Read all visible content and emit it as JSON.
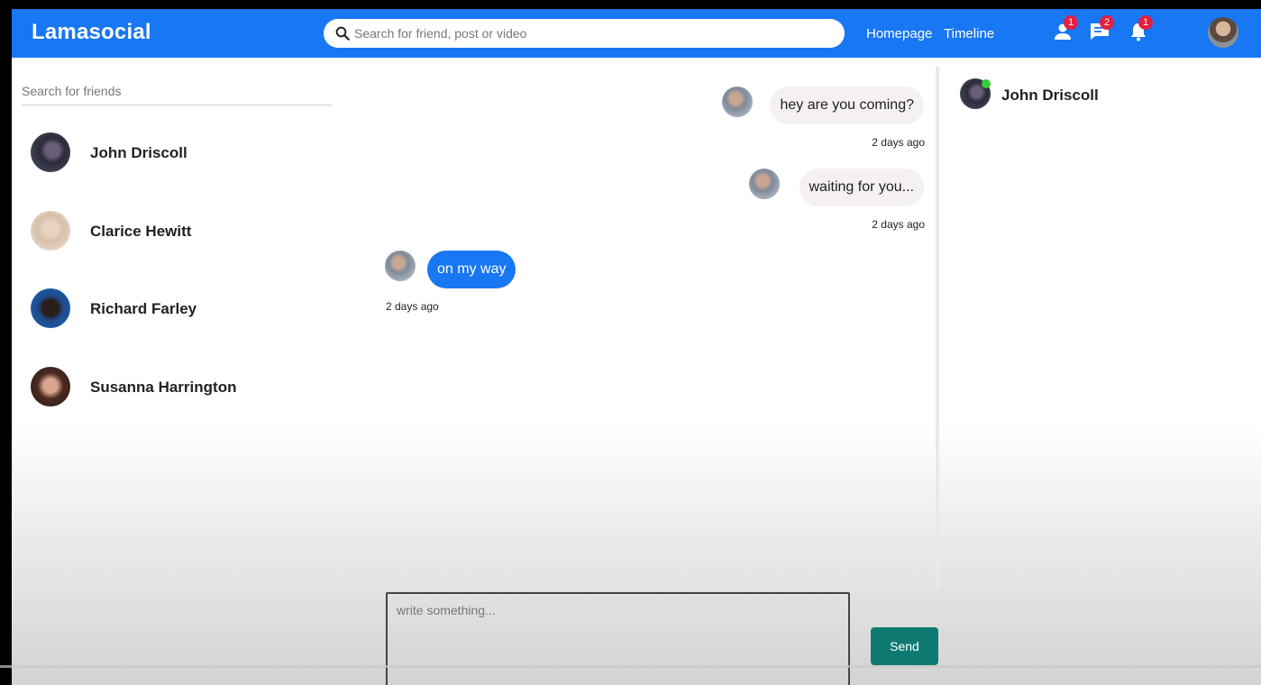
{
  "app": {
    "logo": "Lamasocial"
  },
  "topbar": {
    "search_placeholder": "Search for friend, post or video",
    "links": {
      "homepage": "Homepage",
      "timeline": "Timeline"
    },
    "badges": {
      "friends": "1",
      "messages": "2",
      "notifications": "1"
    },
    "colors": {
      "bar": "#1877f2",
      "badge": "#e41e3f"
    }
  },
  "sidebar": {
    "search_placeholder": "Search for friends",
    "friends": [
      {
        "name": "John Driscoll"
      },
      {
        "name": "Clarice Hewitt"
      },
      {
        "name": "Richard Farley"
      },
      {
        "name": "Susanna Harrington"
      }
    ]
  },
  "chat": {
    "messages": [
      {
        "text": "hey are you coming?",
        "time": "2 days ago",
        "own": false
      },
      {
        "text": "waiting for you...",
        "time": "2 days ago",
        "own": false
      },
      {
        "text": "on my way",
        "time": "2 days ago",
        "own": true
      }
    ],
    "composer_placeholder": "write something...",
    "send_label": "Send",
    "colors": {
      "own_bubble": "#1877f2",
      "other_bubble": "#f5f1f2",
      "send": "#0f7a72"
    }
  },
  "online": {
    "friends": [
      {
        "name": "John Driscoll",
        "status_color": "#32cd32"
      }
    ]
  }
}
